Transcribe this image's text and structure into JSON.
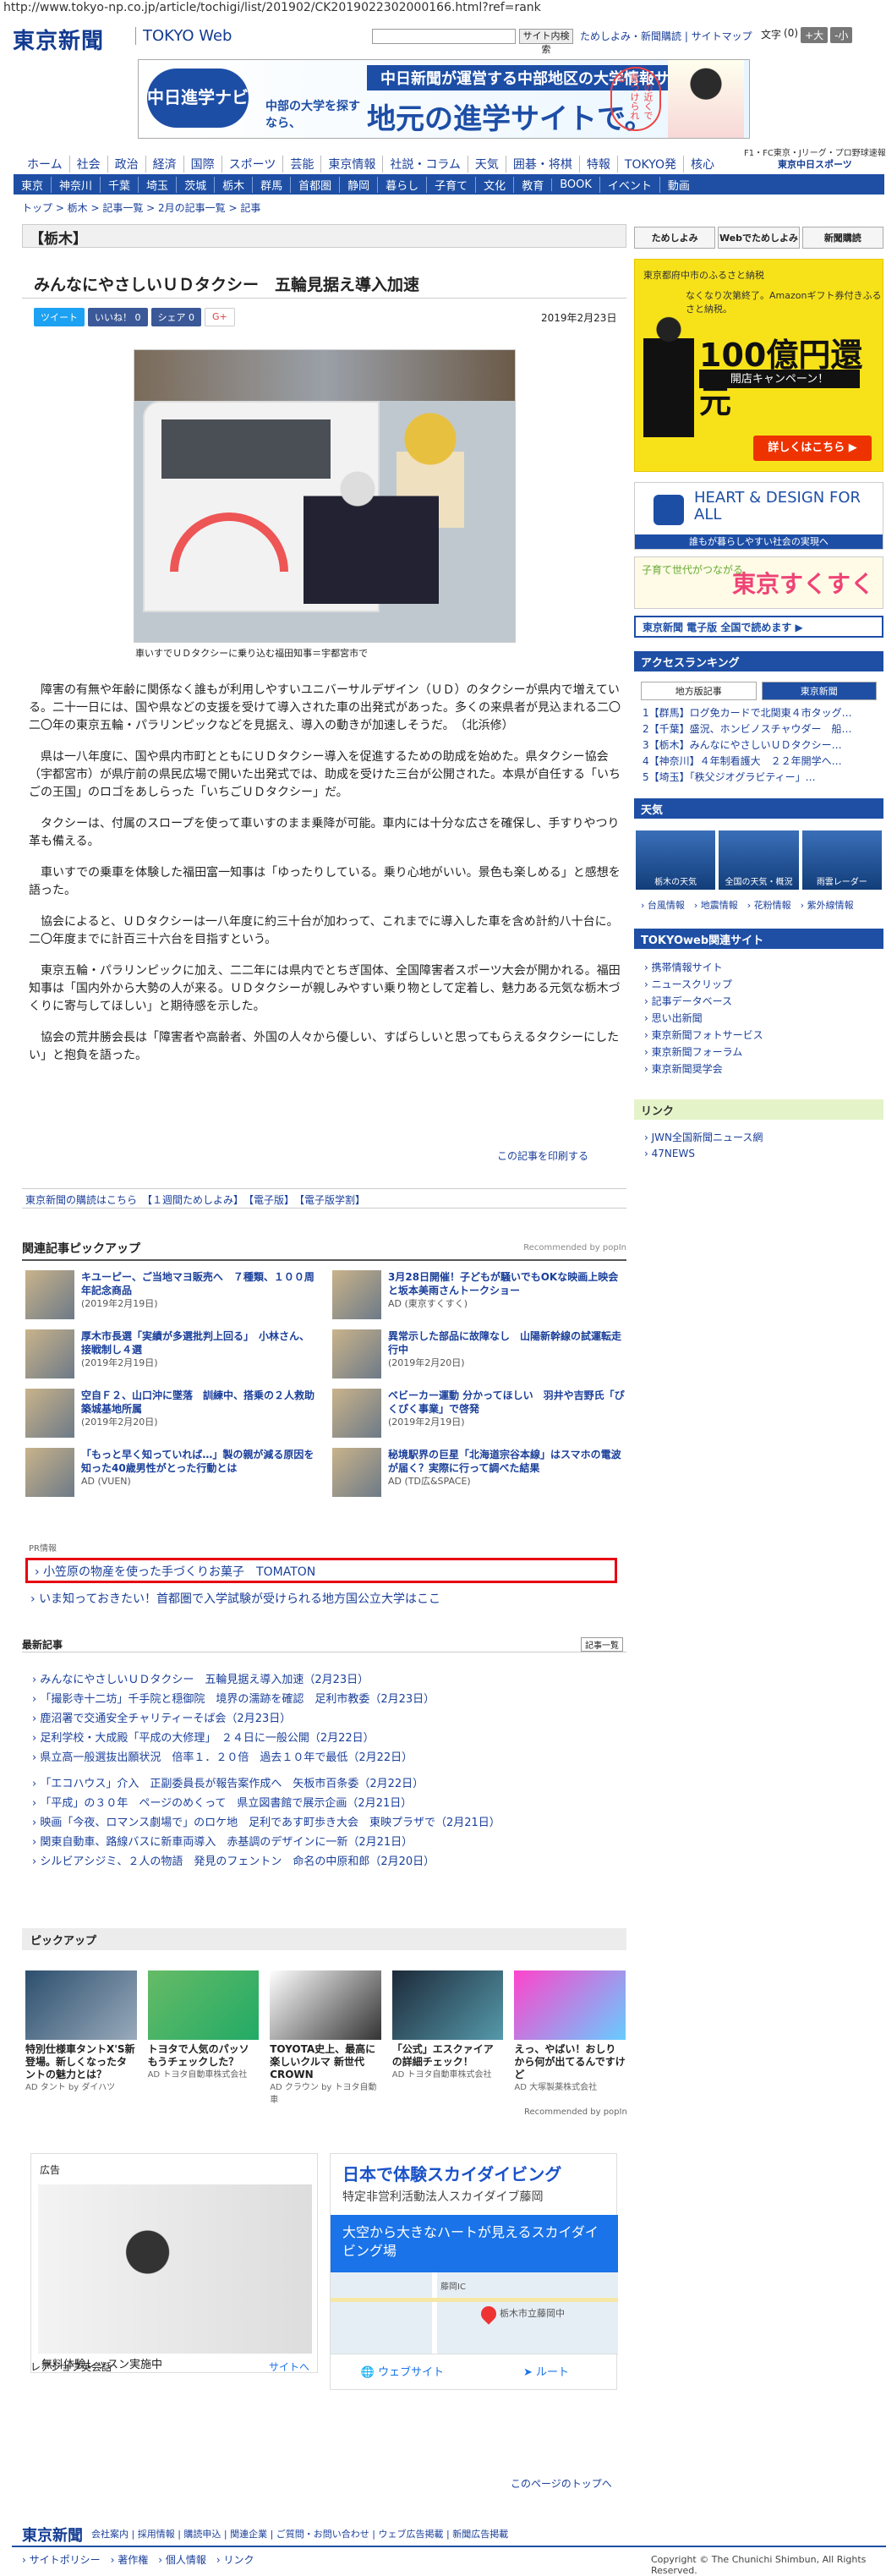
{
  "url": "http://www.tokyo-np.co.jp/article/tochigi/list/201902/CK2019022302000166.html?ref=rank",
  "header": {
    "logo": "東京新聞",
    "logo_sub": "TOKYO Web",
    "search_button": "サイト内検索",
    "links": "ためしよみ・新聞購読 | サイトマップ",
    "font_size_label": "文字",
    "font_size_value": "(0)",
    "font_large": "+大",
    "font_small": "-小"
  },
  "banner": {
    "logo": "中日進学ナビ",
    "top_text": "中日新聞が運営する中部地区の大学情報サイト",
    "sub_text": "中部の大学を探すなら、",
    "main_text": "地元の進学サイトで。",
    "circle_text": "ーの近くで見つけられる"
  },
  "nav_main": [
    "ホーム",
    "社会",
    "政治",
    "経済",
    "国際",
    "スポーツ",
    "芸能",
    "東京情報",
    "社説・コラム",
    "天気",
    "囲碁・将棋",
    "特報",
    "TOKYO発",
    "核心"
  ],
  "nav_right": "F1・FC東京・Jリーグ・プロ野球速報",
  "nav_logo": "東京中日スポーツ",
  "nav_regions": [
    "東京",
    "神奈川",
    "千葉",
    "埼玉",
    "茨城",
    "栃木",
    "群馬",
    "首都圏",
    "静岡",
    "暮らし",
    "子育て",
    "文化",
    "教育",
    "BOOK",
    "イベント",
    "動画"
  ],
  "breadcrumb": "トップ > 栃木 > 記事一覧 > 2月の記事一覧 > 記事",
  "section": "【栃木】",
  "article": {
    "title": "みんなにやさしいＵＤタクシー　五輪見据え導入加速",
    "date": "2019年2月23日",
    "share_tweet": "ツイート",
    "share_fb": "シェア 0",
    "share_like": "いいね！ 0",
    "share_g": "G+",
    "caption": "車いすでＵＤタクシーに乗り込む福田知事＝宇都宮市で",
    "paragraphs": [
      "障害の有無や年齢に関係なく誰もが利用しやすいユニバーサルデザイン（ＵＤ）のタクシーが県内で増えている。二十一日には、国や県などの支援を受けて導入された車の出発式があった。多くの来県者が見込まれる二〇二〇年の東京五輪・パラリンピックなどを見据え、導入の動きが加速しそうだ。　（北浜修）",
      "県は一八年度に、国や県内市町とともにＵＤタクシー導入を促進するための助成を始めた。県タクシー協会（宇都宮市）が県庁前の県民広場で開いた出発式では、助成を受けた三台が公開された。本県が自任する「いちごの王国」のロゴをあしらった「いちごＵＤタクシー」だ。",
      "タクシーは、付属のスロープを使って車いすのまま乗降が可能。車内には十分な広さを確保し、手すりやつり革も備える。",
      "車いすでの乗車を体験した福田富一知事は「ゆったりしている。乗り心地がいい。景色も楽しめる」と感想を語った。",
      "協会によると、ＵＤタクシーは一八年度に約三十台が加わって、これまでに導入した車を含め計約八十台に。二〇年度までに計百三十六台を目指すという。",
      "東京五輪・パラリンピックに加え、二二年には県内でとちぎ国体、全国障害者スポーツ大会が開かれる。福田知事は「国内外から大勢の人が来る。ＵＤタクシーが親しみやすい乗り物として定着し、魅力ある元気な栃木づくりに寄与してほしい」と期待感を示した。",
      "協会の荒井勝会長は「障害者や高齢者、外国の人々から優しい、すばらしいと思ってもらえるタクシーにしたい」と抱負を語った。"
    ],
    "print_link": "この記事を印刷する"
  },
  "sub_links": "東京新聞の購読はこちら　【１週間ためしよみ】　【電子版】　【電子版学割】",
  "related": {
    "heading": "関連記事ピックアップ",
    "powered": "Recommended by popIn",
    "items": [
      {
        "title": "キユーピー、ご当地マヨ販売へ　７種類、１００周年記念商品",
        "date": "(2019年2月19日)"
      },
      {
        "title": "3月28日開催！子どもが騒いでもOKな映画上映会と坂本美雨さんトークショー",
        "date": "AD (東京すくすく)"
      },
      {
        "title": "厚木市長選「実績が多選批判上回る」　小林さん、接戦制し４選",
        "date": "(2019年2月19日)"
      },
      {
        "title": "異常示した部品に故障なし　山陽新幹線の試運転走行中",
        "date": "(2019年2月20日)"
      },
      {
        "title": "空自Ｆ２、山口沖に墜落　訓練中、搭乗の２人救助　築城基地所属",
        "date": "(2019年2月20日)"
      },
      {
        "title": "ベビーカー運動 分かってほしい　羽井や吉野氏「ぴくぴく事業」で啓発",
        "date": "(2019年2月19日)"
      },
      {
        "title": "「もっと早く知っていれば…」製の親が減る原因を知った40歳男性がとった行動とは",
        "date": "AD (VUEN)"
      },
      {
        "title": "秘境駅界の巨星「北海道宗谷本線」はスマホの電波が届く？実際に行って調べた結果",
        "date": "AD (TD広&SPACE)"
      }
    ]
  },
  "pr": {
    "label": "PR情報",
    "line1": "小笠原の物産を使った手づくりお菓子　TOMATON",
    "line2": "いま知っておきたい！首都圏で入学試験が受けられる地方国公立大学はここ"
  },
  "latest": {
    "heading": "最新記事",
    "all": "記事一覧",
    "items": [
      "みんなにやさしいＵＤタクシー　五輪見据え導入加速（2月23日）",
      "「撮影寺十二坊」千手院と穏御院　境界の濡跡を確認　足利市教委（2月23日）",
      "鹿沼署で交通安全チャリティーそば会（2月23日）",
      "足利学校・大成殿「平成の大修理」　２４日に一般公開（2月22日）",
      "県立高一般選抜出願状況　倍率１．２０倍　過去１０年で最低（2月22日）",
      "「エコハウス」介入　正副委員長が報告案作成へ　矢板市百条委（2月22日）",
      "「平成」の３０年　ページのめくって　県立図書館で展示企画（2月21日）",
      "映画「今夜、ロマンス劇場で」のロケ地　足利であす町歩き大会　東映プラザで（2月21日）",
      "関東自動車、路線バスに新車両導入　赤基調のデザインに一新（2月21日）",
      "シルビアシジミ、２人の物語　発見のフェントン　命名の中原和郎（2月20日）"
    ]
  },
  "pickup": {
    "heading": "ピックアップ",
    "items": [
      {
        "title": "特別仕様車タントX'S新登場。新しくなったタントの魅力とは？",
        "ad": "AD タント by ダイハツ",
        "c1": "#2c4f6e",
        "c2": "#9ab"
      },
      {
        "title": "トヨタで人気のパッソもうチェックした？",
        "ad": "AD トヨタ自動車株式会社",
        "c1": "#6b6",
        "c2": "#2a6"
      },
      {
        "title": "TOYOTA史上、最高に楽しいクルマ 新世代CROWN",
        "ad": "AD クラウン by トヨタ自動車",
        "c1": "#fff",
        "c2": "#333"
      },
      {
        "title": "「公式」エスクァイアの詳細チェック！",
        "ad": "AD トヨタ自動車株式会社",
        "c1": "#1d2a3a",
        "c2": "#59a"
      },
      {
        "title": "えっ、やばい！おしりから何が出てるんですけど",
        "ad": "AD 大塚製薬株式会社",
        "c1": "#f4c",
        "c2": "#6cf"
      }
    ],
    "powered": "Recommended by popIn"
  },
  "ads": {
    "left_label": "広告",
    "left_caption": "無料体験レッスン実施中",
    "left_brand": "レアジョブ英会話",
    "left_link": "サイトへ",
    "right_title": "日本で体験スカイダイビング",
    "right_sub": "特定非営利活動法人スカイダイブ藤岡",
    "right_blue": "大空から大きなハートが見えるスカイダイビング場",
    "right_web": "ウェブサイト",
    "right_route": "ルート",
    "map_label1": "藤岡IC",
    "map_label2": "栃木市立藤岡中"
  },
  "footer": {
    "totop": "このページのトップへ",
    "logo": "東京新聞",
    "links": "会社案内 | 採用情報 | 購読申込 | 関連企業 | ご質問・お問い合わせ | ウェブ広告掲載 | 新聞広告掲載",
    "links2": "› サイトポリシー　› 著作権　› 個人情報　› リンク",
    "copyright": "Copyright © The Chunichi Shimbun, All Rights Reserved."
  },
  "sidebar": {
    "top_buttons": [
      "ためしよみ",
      "Webでためしよみ",
      "新聞購読"
    ],
    "ad1_l1": "東京都府中市のふるさと納税",
    "ad1_l2": "なくなり次第終了。Amazonギフト券付きふるさと納税。",
    "ad1_big": "100億円還元",
    "ad1_sub": "開店キャンペーン！",
    "ad1_btn": "詳しくはこちら ▶",
    "hd_title": "HEART & DESIGN FOR ALL",
    "hd_sub": "誰もが暮らしやすい社会の実現へ",
    "kosodate_a": "子育て世代がつながる",
    "kosodate_b": "東京すくすく",
    "denshi": "東京新聞 電子版 全国で読めます ▶",
    "rank_heading": "アクセスランキング",
    "rank_tabs": [
      "地方版記事",
      "東京新聞"
    ],
    "rank_items": [
      "1【群馬】ログ免カードで北関東４市タッグ…",
      "2【千葉】盛況、ホンビノスチャウダー　船…",
      "3【栃木】みんなにやさしいＵＤタクシー…",
      "4【神奈川】４年制看護大　２２年開学へ…",
      "5【埼玉】「秩父ジオグラビティー」…"
    ],
    "wx_heading": "天気",
    "wx_items": [
      "栃木の天気",
      "全国の天気・概況",
      "雨雲レーダー"
    ],
    "wx_links": "› 台風情報　› 地震情報　› 花粉情報　› 紫外線情報",
    "tk_heading": "TOKYOweb関連サイト",
    "tk_items": [
      "携帯情報サイト",
      "ニュースクリップ",
      "記事データベース",
      "思い出新聞",
      "東京新聞フォトサービス",
      "東京新聞フォーラム",
      "東京新聞奨学会"
    ],
    "link_heading": "リンク",
    "link_items": [
      "JWN全国新聞ニュース網",
      "47NEWS"
    ]
  }
}
